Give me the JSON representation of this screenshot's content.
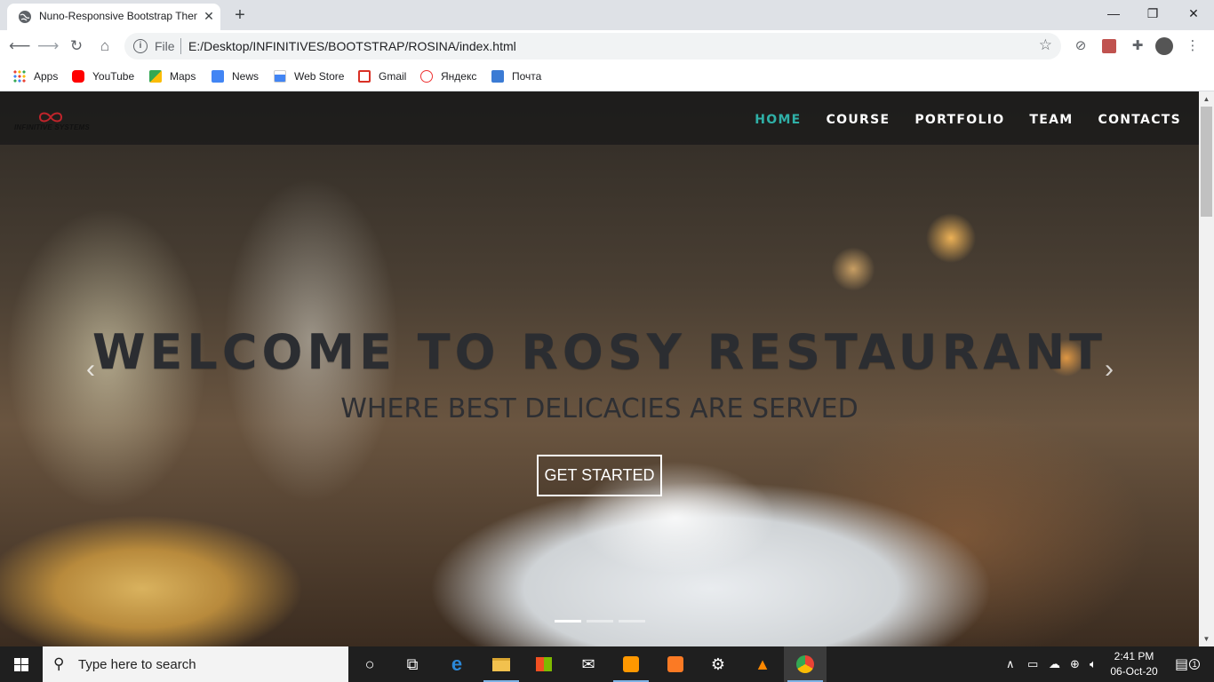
{
  "browser": {
    "tab_title": "Nuno-Responsive Bootstrap Theme",
    "new_tab": "+",
    "scheme": "File",
    "url": "E:/Desktop/INFINITIVES/BOOTSTRAP/ROSINA/index.html",
    "bookmarks": [
      "Apps",
      "YouTube",
      "Maps",
      "News",
      "Web Store",
      "Gmail",
      "Яндекс",
      "Почта"
    ]
  },
  "site": {
    "logo_text": "INFINITIVE SYSTEMS",
    "nav": [
      "HOME",
      "COURSE",
      "PORTFOLIO",
      "TEAM",
      "CONTACTS"
    ],
    "active_nav": "HOME",
    "hero_title": "WELCOME TO ROSY RESTAURANT",
    "hero_subtitle": "WHERE BEST DELICACIES ARE SERVED",
    "cta": "GET STARTED"
  },
  "taskbar": {
    "search_placeholder": "Type here to search",
    "time": "2:41 PM",
    "date": "06-Oct-20",
    "notification_count": "1"
  },
  "colors": {
    "accent": "#2fb0a7",
    "navbar": "#191919",
    "taskbar": "#1f1f1f"
  }
}
